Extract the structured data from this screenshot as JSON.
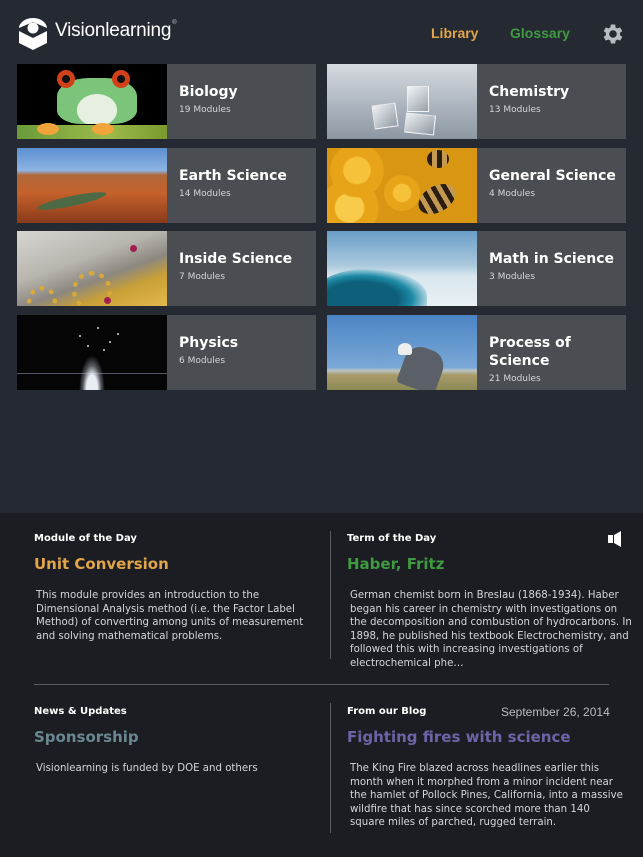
{
  "header": {
    "brand": "Visionlearning",
    "brand_mark": "®",
    "nav": {
      "library": "Library",
      "glossary": "Glossary"
    },
    "settings_icon": "gear-icon",
    "colors": {
      "library": "#e3a549",
      "glossary": "#3f9a42"
    }
  },
  "categories": [
    {
      "title": "Biology",
      "count": "19 Modules",
      "image": "tree frog"
    },
    {
      "title": "Chemistry",
      "count": "13 Modules",
      "image": "ice cubes"
    },
    {
      "title": "Earth Science",
      "count": "14 Modules",
      "image": "canyon"
    },
    {
      "title": "General Science",
      "count": "4 Modules",
      "image": "honeybees on honeycomb"
    },
    {
      "title": "Inside Science",
      "count": "7 Modules",
      "image": "watch gears"
    },
    {
      "title": "Math in Science",
      "count": "3 Modules",
      "image": "ocean wave"
    },
    {
      "title": "Physics",
      "count": "6 Modules",
      "image": "water splash"
    },
    {
      "title": "Process of Science",
      "count": "21 Modules",
      "image": "scientist in field"
    }
  ],
  "module_of_day": {
    "label": "Module of the Day",
    "title": "Unit Conversion",
    "body": "This module provides an introduction to the Dimensional Analysis method (i.e. the Factor Label Method) of converting among units of measurement and solving mathematical problems.",
    "color": "#e3a549"
  },
  "term_of_day": {
    "label": "Term of the Day",
    "title": "Haber, Fritz",
    "body": "German chemist born in Breslau (1868-1934). Haber began his career in chemistry with investigations on the decomposition and combustion of hydrocarbons. In 1898, he published his textbook Electrochemistry, and followed this with increasing investigations of electrochemical phe…",
    "audio_icon": "speaker-icon",
    "color": "#3f9a42"
  },
  "news": {
    "label": "News & Updates",
    "title": "Sponsorship",
    "body": "Visionlearning is funded by DOE and others",
    "color": "#6a8792"
  },
  "blog": {
    "label": "From our Blog",
    "date": "September 26, 2014",
    "title": "Fighting fires with science",
    "body": "The King Fire blazed across headlines earlier this month when it morphed from a minor incident near the hamlet of Pollock Pines, California, into a massive wildfire that has since scorched more than 140 square miles of parched, rugged terrain.",
    "color": "#6f63a8"
  }
}
